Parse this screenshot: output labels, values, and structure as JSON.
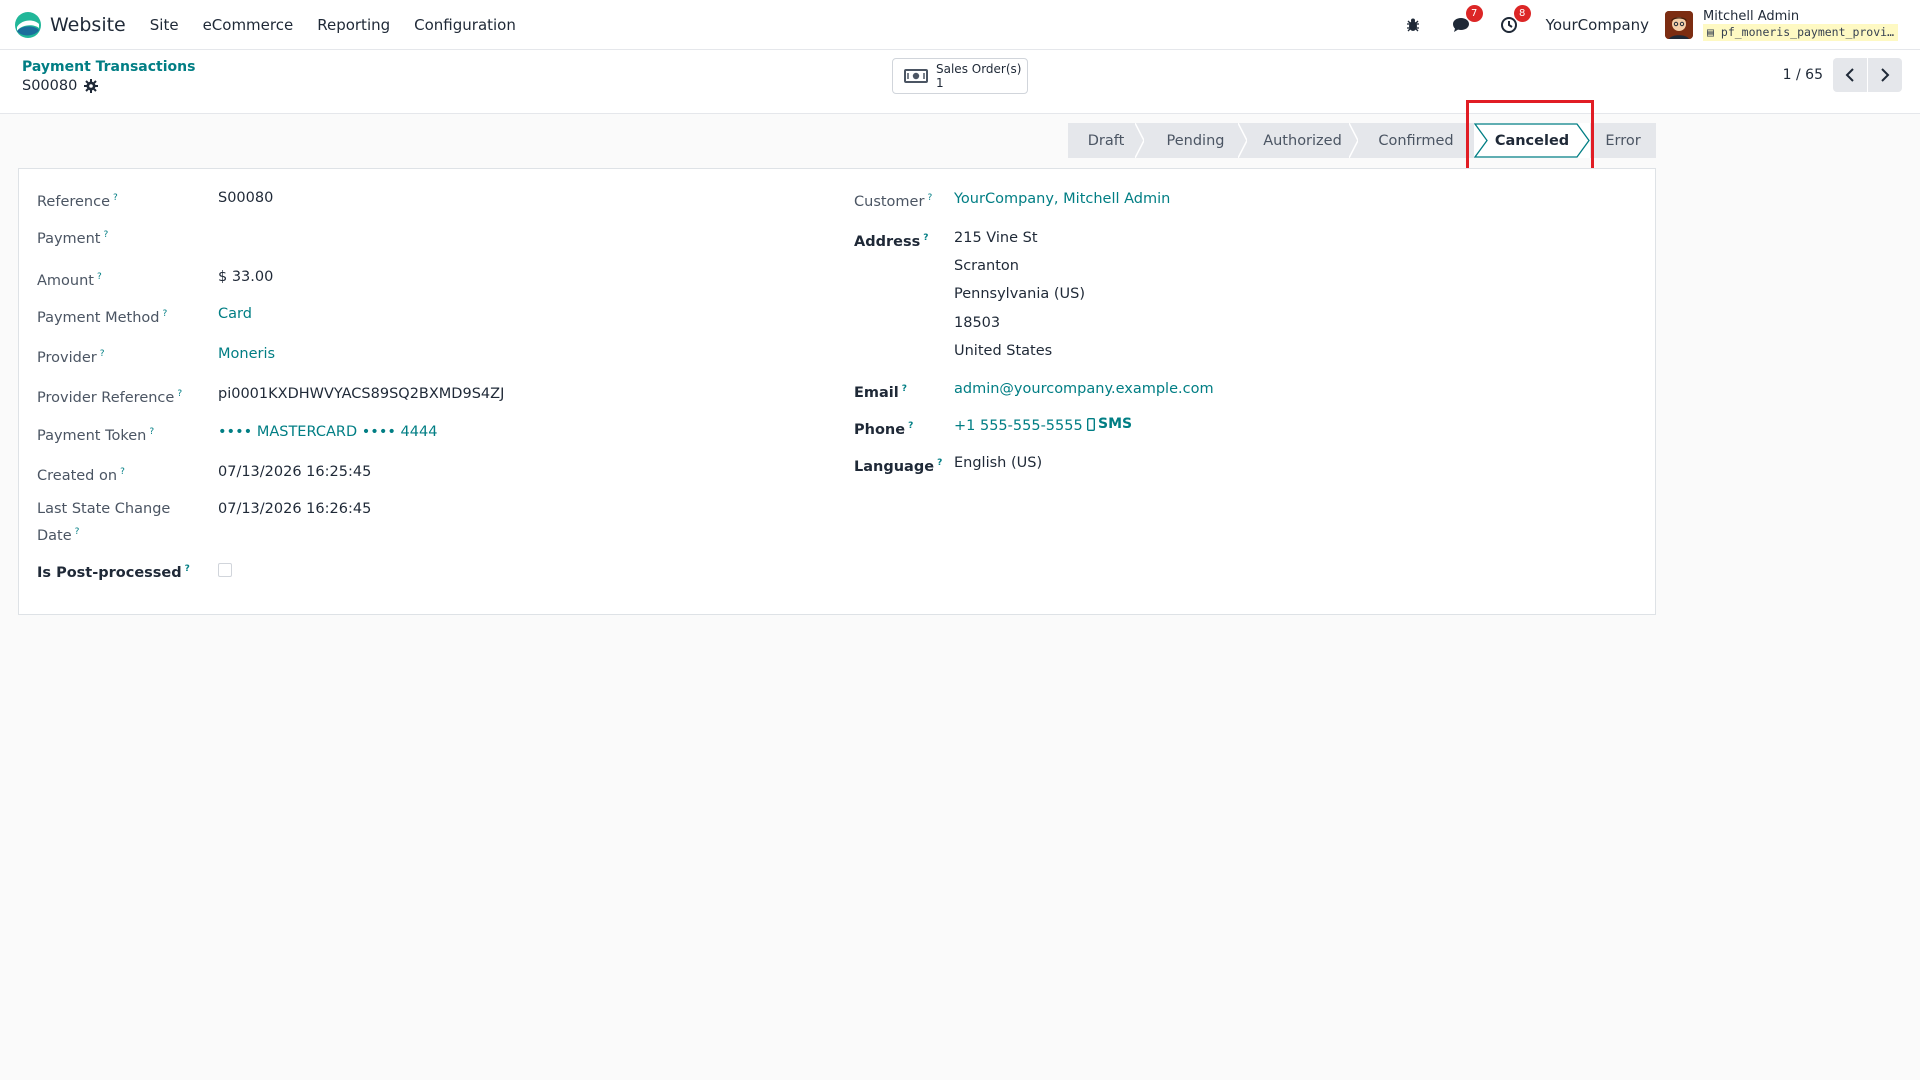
{
  "navbar": {
    "app_name": "Website",
    "menu": [
      "Site",
      "eCommerce",
      "Reporting",
      "Configuration"
    ],
    "messages_count": "7",
    "activities_count": "8",
    "company": "YourCompany",
    "user_name": "Mitchell Admin",
    "database": "pf_moneris_payment_provi…"
  },
  "control": {
    "breadcrumb": "Payment Transactions",
    "record_name": "S00080",
    "smart_button": {
      "label": "Sales Order(s)",
      "count": "1"
    },
    "pager": "1 / 65"
  },
  "statusbar": {
    "stages": [
      "Draft",
      "Pending",
      "Authorized",
      "Confirmed",
      "Canceled",
      "Error"
    ],
    "active": "Canceled"
  },
  "form": {
    "left": [
      {
        "label": "Reference",
        "value": "S00080",
        "link": false
      },
      {
        "label": "Payment",
        "value": "",
        "link": false
      },
      {
        "label": "Amount",
        "value": "$ 33.00",
        "link": false
      },
      {
        "label": "Payment Method",
        "value": "Card",
        "link": true
      },
      {
        "label": "Provider",
        "value": "Moneris",
        "link": true
      },
      {
        "label": "Provider Reference",
        "value": "pi0001KXDHWVYACS89SQ2BXMD9S4ZJ",
        "link": false
      },
      {
        "label": "Payment Token",
        "value": "•••• MASTERCARD •••• 4444",
        "link": true
      },
      {
        "label": "Created on",
        "value": "07/13/2026 16:25:45",
        "link": false
      },
      {
        "label": "Last State Change",
        "label2": "Date",
        "value": "07/13/2026 16:26:45",
        "link": false
      },
      {
        "label": "Is Post-processed",
        "checked": false
      }
    ],
    "right": {
      "customer_label": "Customer",
      "customer": "YourCompany, Mitchell Admin",
      "address_label": "Address",
      "address_lines": [
        "215 Vine St",
        "Scranton",
        "Pennsylvania (US)",
        "18503",
        "United States"
      ],
      "email_label": "Email",
      "email": "admin@yourcompany.example.com",
      "phone_label": "Phone",
      "phone": "+1 555-555-5555",
      "sms_label": "SMS",
      "language_label": "Language",
      "language": "English (US)"
    },
    "help_mark": "?"
  },
  "colors": {
    "accent": "#017e84",
    "highlight": "#e11d24",
    "badge": "#dc2626"
  }
}
